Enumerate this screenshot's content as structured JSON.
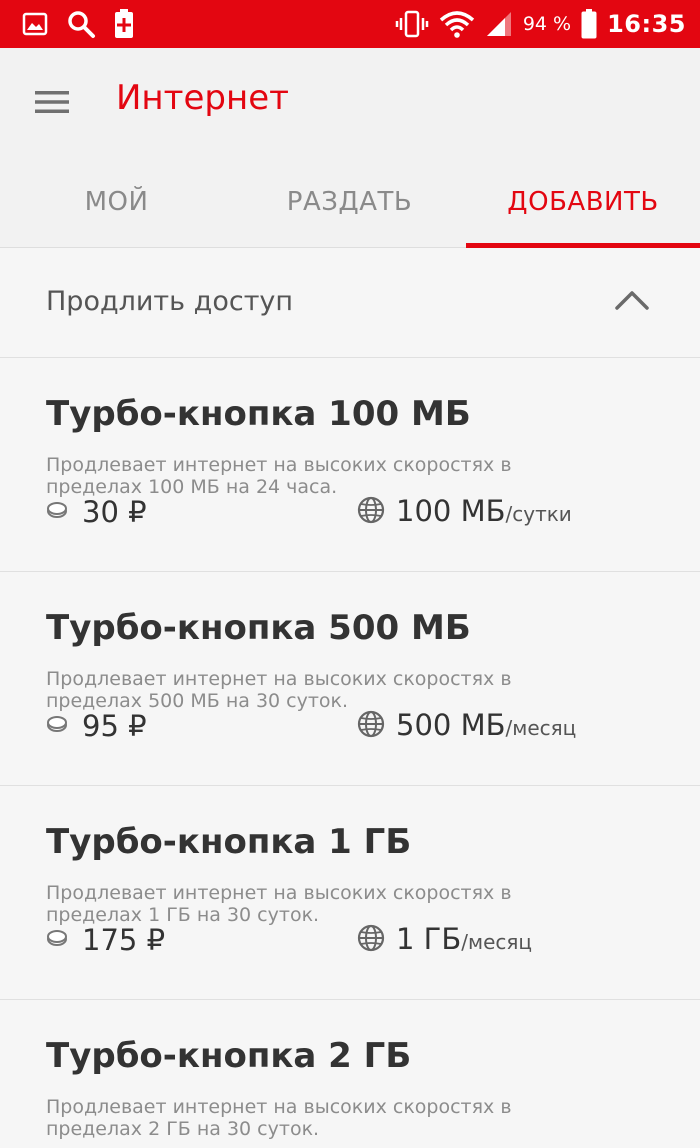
{
  "status_bar": {
    "icons": [
      "gallery-icon",
      "search-icon",
      "battery-plus-icon",
      "vibrate-icon",
      "wifi-icon",
      "signal-icon",
      "battery-icon"
    ],
    "battery_percent": "94 %",
    "time": "16:35"
  },
  "header": {
    "menu_icon": "hamburger-menu-icon",
    "title": "Интернет"
  },
  "tabs": [
    {
      "label": "МОЙ",
      "active": false
    },
    {
      "label": "РАЗДАТЬ",
      "active": false
    },
    {
      "label": "ДОБАВИТЬ",
      "active": true
    }
  ],
  "section": {
    "title": "Продлить доступ",
    "toggle_icon": "chevron-up-icon"
  },
  "offers": [
    {
      "title": "Турбо-кнопка 100 МБ",
      "description": "Продлевает интернет на высоких скоростях в пределах 100 МБ на 24 часа.",
      "price": "30 ₽",
      "volume": "100 МБ",
      "period": "/сутки"
    },
    {
      "title": "Турбо-кнопка 500 МБ",
      "description": "Продлевает интернет на высоких скоростях в пределах 500 МБ на 30 суток.",
      "price": "95 ₽",
      "volume": "500 МБ",
      "period": "/месяц"
    },
    {
      "title": "Турбо-кнопка 1 ГБ",
      "description": "Продлевает интернет на высоких скоростях в пределах 1 ГБ на 30 суток.",
      "price": "175 ₽",
      "volume": "1 ГБ",
      "period": "/месяц"
    },
    {
      "title": "Турбо-кнопка 2 ГБ",
      "description": "Продлевает интернет на высоких скоростях в пределах 2 ГБ на 30 суток."
    }
  ],
  "colors": {
    "brand_red": "#e30611",
    "background": "#f6f6f6",
    "text_dark": "#333333",
    "text_muted": "#8c8c8c"
  }
}
